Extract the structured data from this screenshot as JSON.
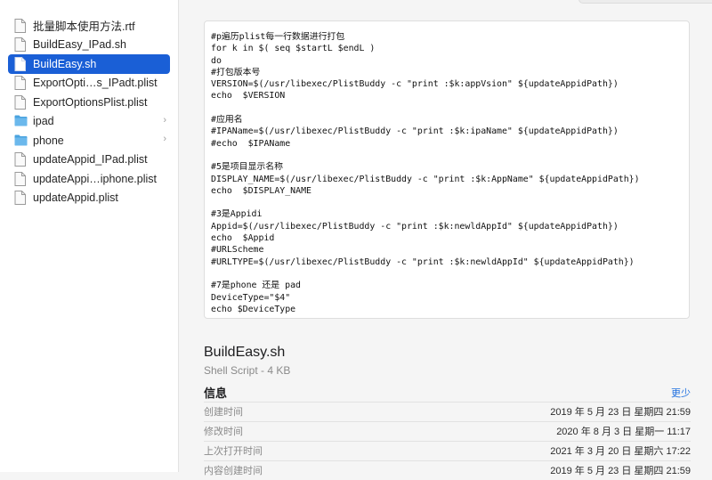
{
  "sidebar": {
    "items": [
      {
        "label": "批量脚本使用方法.rtf",
        "type": "file",
        "selected": false
      },
      {
        "label": "BuildEasy_IPad.sh",
        "type": "file",
        "selected": false
      },
      {
        "label": "BuildEasy.sh",
        "type": "file",
        "selected": true
      },
      {
        "label": "ExportOpti…s_IPadt.plist",
        "type": "file",
        "selected": false
      },
      {
        "label": "ExportOptionsPlist.plist",
        "type": "file",
        "selected": false
      },
      {
        "label": "ipad",
        "type": "folder",
        "selected": false
      },
      {
        "label": "phone",
        "type": "folder",
        "selected": false
      },
      {
        "label": "updateAppid_IPad.plist",
        "type": "file",
        "selected": false
      },
      {
        "label": "updateAppi…iphone.plist",
        "type": "file",
        "selected": false
      },
      {
        "label": "updateAppid.plist",
        "type": "file",
        "selected": false
      }
    ]
  },
  "preview": {
    "code": "#p遍历plist每一行数据进行打包\nfor k in $( seq $startL $endL )\ndo\n#打包版本号\nVERSION=$(/usr/libexec/PlistBuddy -c \"print :$k:appVsion\" ${updateAppidPath})\necho  $VERSION\n\n#应用名\n#IPAName=$(/usr/libexec/PlistBuddy -c \"print :$k:ipaName\" ${updateAppidPath})\n#echo  $IPAName\n\n#5是项目显示名称\nDISPLAY_NAME=$(/usr/libexec/PlistBuddy -c \"print :$k:AppName\" ${updateAppidPath})\necho  $DISPLAY_NAME\n\n#3是Appidi\nAppid=$(/usr/libexec/PlistBuddy -c \"print :$k:newldAppId\" ${updateAppidPath})\necho  $Appid\n#URLScheme\n#URLTYPE=$(/usr/libexec/PlistBuddy -c \"print :$k:newldAppId\" ${updateAppidPath})\n\n#7是phone 还是 pad\nDeviceType=\"$4\"\necho $DeviceType"
  },
  "file_info": {
    "name": "BuildEasy.sh",
    "type_size": "Shell Script - 4 KB",
    "info_title": "信息",
    "more_label": "更少",
    "rows": [
      {
        "key": "创建时间",
        "value": "2019 年 5 月 23 日 星期四 21:59"
      },
      {
        "key": "修改时间",
        "value": "2020 年 8 月 3 日 星期一 11:17"
      },
      {
        "key": "上次打开时间",
        "value": "2021 年 3 月 20 日 星期六 17:22"
      },
      {
        "key": "内容创建时间",
        "value": "2019 年 5 月 23 日 星期四 21:59"
      }
    ]
  },
  "colors": {
    "selection": "#1a5fd6",
    "link": "#2070e0",
    "folder": "#4aa3df"
  }
}
